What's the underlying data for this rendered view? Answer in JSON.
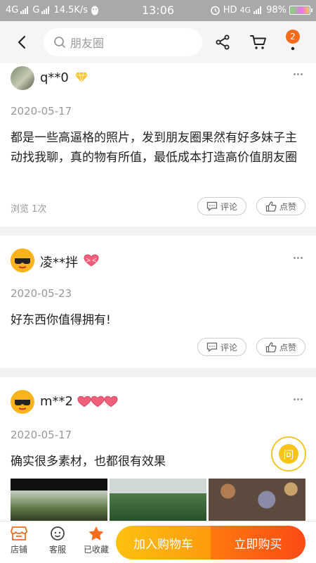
{
  "status_bar": {
    "left_network_1": "4G",
    "left_network_2": "G",
    "speed": "14.5K/s",
    "time": "13:06",
    "hd_label": "HD",
    "right_network": "4G",
    "battery": "98%"
  },
  "nav": {
    "search_placeholder": "朋友圈",
    "notification_count": "2"
  },
  "posts": [
    {
      "username": "q**0",
      "date": "2020-05-17",
      "text": "都是一些高逼格的照片，发到朋友圈果然有好多妹子主动找我聊，真的物有所值，最低成本打造高价值朋友圈",
      "views": "浏览 1次",
      "comment_label": "评论",
      "like_label": "点赞"
    },
    {
      "username": "凌**拌",
      "date": "2020-05-23",
      "text": "好东西你值得拥有!",
      "comment_label": "评论",
      "like_label": "点赞"
    },
    {
      "username": "m**2",
      "date": "2020-05-17",
      "text": "确实很多素材，也都很有效果"
    }
  ],
  "float_button": "问",
  "bottom_bar": {
    "store": "店铺",
    "service": "客服",
    "favorite": "已收藏",
    "add_to_cart": "加入购物车",
    "buy_now": "立即购买"
  },
  "colors": {
    "accent_orange": "#f46b1e",
    "cta_yellow": "#fcc110",
    "cta_red": "#fb4a14",
    "diamond_gold": "#f6c12b",
    "heart_pink": "#f0607a"
  }
}
